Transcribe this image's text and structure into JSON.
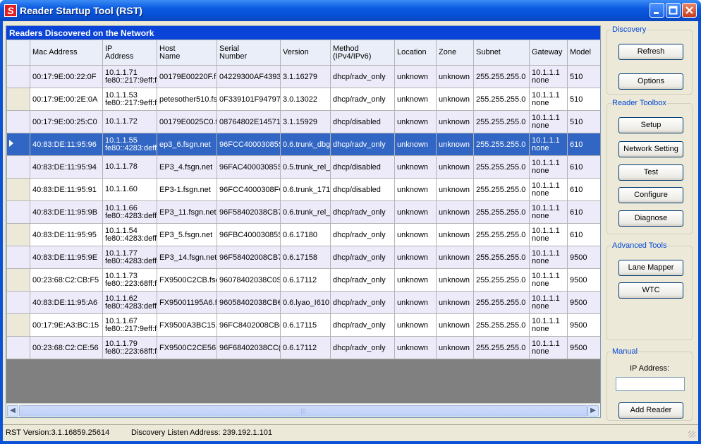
{
  "window": {
    "title": "Reader Startup Tool (RST)",
    "icon_letter": "S"
  },
  "panel": {
    "title": "Readers Discovered on the Network"
  },
  "columns": [
    {
      "l1": "",
      "l2": ""
    },
    {
      "l1": "Mac Address",
      "l2": ""
    },
    {
      "l1": "IP",
      "l2": "Address"
    },
    {
      "l1": "Host",
      "l2": "Name"
    },
    {
      "l1": "Serial",
      "l2": "Number"
    },
    {
      "l1": "Version",
      "l2": ""
    },
    {
      "l1": "Method",
      "l2": "(IPv4/IPv6)"
    },
    {
      "l1": "Location",
      "l2": ""
    },
    {
      "l1": "Zone",
      "l2": ""
    },
    {
      "l1": "Subnet",
      "l2": ""
    },
    {
      "l1": "Gateway",
      "l2": ""
    },
    {
      "l1": "Model",
      "l2": ""
    }
  ],
  "rows": [
    {
      "mac": "00:17:9E:00:22:0F",
      "ip1": "10.1.1.71",
      "ip2": "fe80::217:9eff:f",
      "host": "00179E00220F.f",
      "serial": "04229300AF4393",
      "version": "3.1.16279",
      "method": "dhcp/radv_only",
      "location": "unknown",
      "zone": "unknown",
      "subnet": "255.255.255.0",
      "gw1": "10.1.1.1",
      "gw2": "none",
      "model": "510"
    },
    {
      "mac": "00:17:9E:00:2E:0A",
      "ip1": "10.1.1.53",
      "ip2": "fe80::217:9eff:f",
      "host": "petesother510.fs",
      "serial": "0F339101F94797",
      "version": "3.0.13022",
      "method": "dhcp/radv_only",
      "location": "unknown",
      "zone": "unknown",
      "subnet": "255.255.255.0",
      "gw1": "10.1.1.1",
      "gw2": "none",
      "model": "510"
    },
    {
      "mac": "00:17:9E:00:25:C0",
      "ip1": "10.1.1.72",
      "ip2": "",
      "host": "00179E0025C0.f",
      "serial": "08764802E14571",
      "version": "3.1.15929",
      "method": "dhcp/disabled",
      "location": "unknown",
      "zone": "unknown",
      "subnet": "255.255.255.0",
      "gw1": "10.1.1.1",
      "gw2": "none",
      "model": "510"
    },
    {
      "mac": "40:83:DE:11:95:96",
      "ip1": "10.1.1.55",
      "ip2": "fe80::4283:deff",
      "host": "ep3_6.fsgn.net",
      "serial": "96FCC40003085S",
      "version": "0.6.trunk_dbg",
      "method": "dhcp/radv_only",
      "location": "unknown",
      "zone": "unknown",
      "subnet": "255.255.255.0",
      "gw1": "10.1.1.1",
      "gw2": "none",
      "model": "610"
    },
    {
      "mac": "40:83:DE:11:95:94",
      "ip1": "10.1.1.78",
      "ip2": "",
      "host": "EP3_4.fsgn.net",
      "serial": "96FAC40003085S",
      "version": "0.5.trunk_rel_",
      "method": "dhcp/disabled",
      "location": "unknown",
      "zone": "unknown",
      "subnet": "255.255.255.0",
      "gw1": "10.1.1.1",
      "gw2": "none",
      "model": "610"
    },
    {
      "mac": "40:83:DE:11:95:91",
      "ip1": "10.1.1.60",
      "ip2": "",
      "host": "EP3-1.fsgn.net",
      "serial": "96FCC4000308F€",
      "version": "0.6.trunk_171",
      "method": "dhcp/disabled",
      "location": "unknown",
      "zone": "unknown",
      "subnet": "255.255.255.0",
      "gw1": "10.1.1.1",
      "gw2": "none",
      "model": "610"
    },
    {
      "mac": "40:83:DE:11:95:9B",
      "ip1": "10.1.1.66",
      "ip2": "fe80::4283:deff",
      "host": "EP3_11.fsgn.net",
      "serial": "96F58402038CB7",
      "version": "0.6.trunk_rel_",
      "method": "dhcp/radv_only",
      "location": "unknown",
      "zone": "unknown",
      "subnet": "255.255.255.0",
      "gw1": "10.1.1.1",
      "gw2": "none",
      "model": "610"
    },
    {
      "mac": "40:83:DE:11:95:95",
      "ip1": "10.1.1.54",
      "ip2": "fe80::4283:deff",
      "host": "EP3_5.fsgn.net",
      "serial": "96FBC40003085S",
      "version": "0.6.17180",
      "method": "dhcp/radv_only",
      "location": "unknown",
      "zone": "unknown",
      "subnet": "255.255.255.0",
      "gw1": "10.1.1.1",
      "gw2": "none",
      "model": "610"
    },
    {
      "mac": "40:83:DE:11:95:9E",
      "ip1": "10.1.1.77",
      "ip2": "fe80::4283:deff",
      "host": "EP3_14.fsgn.net",
      "serial": "96F58402008CB7",
      "version": "0.6.17158",
      "method": "dhcp/radv_only",
      "location": "unknown",
      "zone": "unknown",
      "subnet": "255.255.255.0",
      "gw1": "10.1.1.1",
      "gw2": "none",
      "model": "9500"
    },
    {
      "mac": "00:23:68:C2:CB:F5",
      "ip1": "10.1.1.73",
      "ip2": "fe80::223:68ff:f",
      "host": "FX9500C2CB.fsc",
      "serial": "96078402038C0S",
      "version": "0.6.17112",
      "method": "dhcp/radv_only",
      "location": "unknown",
      "zone": "unknown",
      "subnet": "255.255.255.0",
      "gw1": "10.1.1.1",
      "gw2": "none",
      "model": "9500"
    },
    {
      "mac": "40:83:DE:11:95:A6",
      "ip1": "10.1.1.62",
      "ip2": "fe80::4283:deff",
      "host": "FX95001195A6.f",
      "serial": "96058402038CB€",
      "version": "0.6.lyao_I610",
      "method": "dhcp/radv_only",
      "location": "unknown",
      "zone": "unknown",
      "subnet": "255.255.255.0",
      "gw1": "10.1.1.1",
      "gw2": "none",
      "model": "9500"
    },
    {
      "mac": "00:17:9E:A3:BC:15",
      "ip1": "10.1.1.67",
      "ip2": "fe80::217:9eff:f",
      "host": "FX9500A3BC15.",
      "serial": "96FC8402008CB(",
      "version": "0.6.17115",
      "method": "dhcp/radv_only",
      "location": "unknown",
      "zone": "unknown",
      "subnet": "255.255.255.0",
      "gw1": "10.1.1.1",
      "gw2": "none",
      "model": "9500"
    },
    {
      "mac": "00:23:68:C2:CE:56",
      "ip1": "10.1.1.79",
      "ip2": "fe80::223:68ff:f",
      "host": "FX9500C2CE56.",
      "serial": "96F68402038CC(",
      "version": "0.6.17112",
      "method": "dhcp/radv_only",
      "location": "unknown",
      "zone": "unknown",
      "subnet": "255.255.255.0",
      "gw1": "10.1.1.1",
      "gw2": "none",
      "model": "9500"
    }
  ],
  "selected_row": 3,
  "discovery": {
    "legend": "Discovery",
    "refresh": "Refresh",
    "options": "Options"
  },
  "toolbox": {
    "legend": "Reader Toolbox",
    "setup": "Setup",
    "network": "Network Setting",
    "test": "Test",
    "configure": "Configure",
    "diagnose": "Diagnose"
  },
  "advanced": {
    "legend": "Advanced Tools",
    "lane_mapper": "Lane Mapper",
    "wtc": "WTC"
  },
  "manual": {
    "legend": "Manual",
    "ip_label": "IP Address:",
    "ip_value": "",
    "add": "Add Reader"
  },
  "status": {
    "version": "RST Version:3.1.16859.25614",
    "discovery": "Discovery Listen Address: 239.192.1.101"
  },
  "icons": {
    "scroll_left": "◀",
    "scroll_right": "▶",
    "thumb_grip": "|||"
  }
}
